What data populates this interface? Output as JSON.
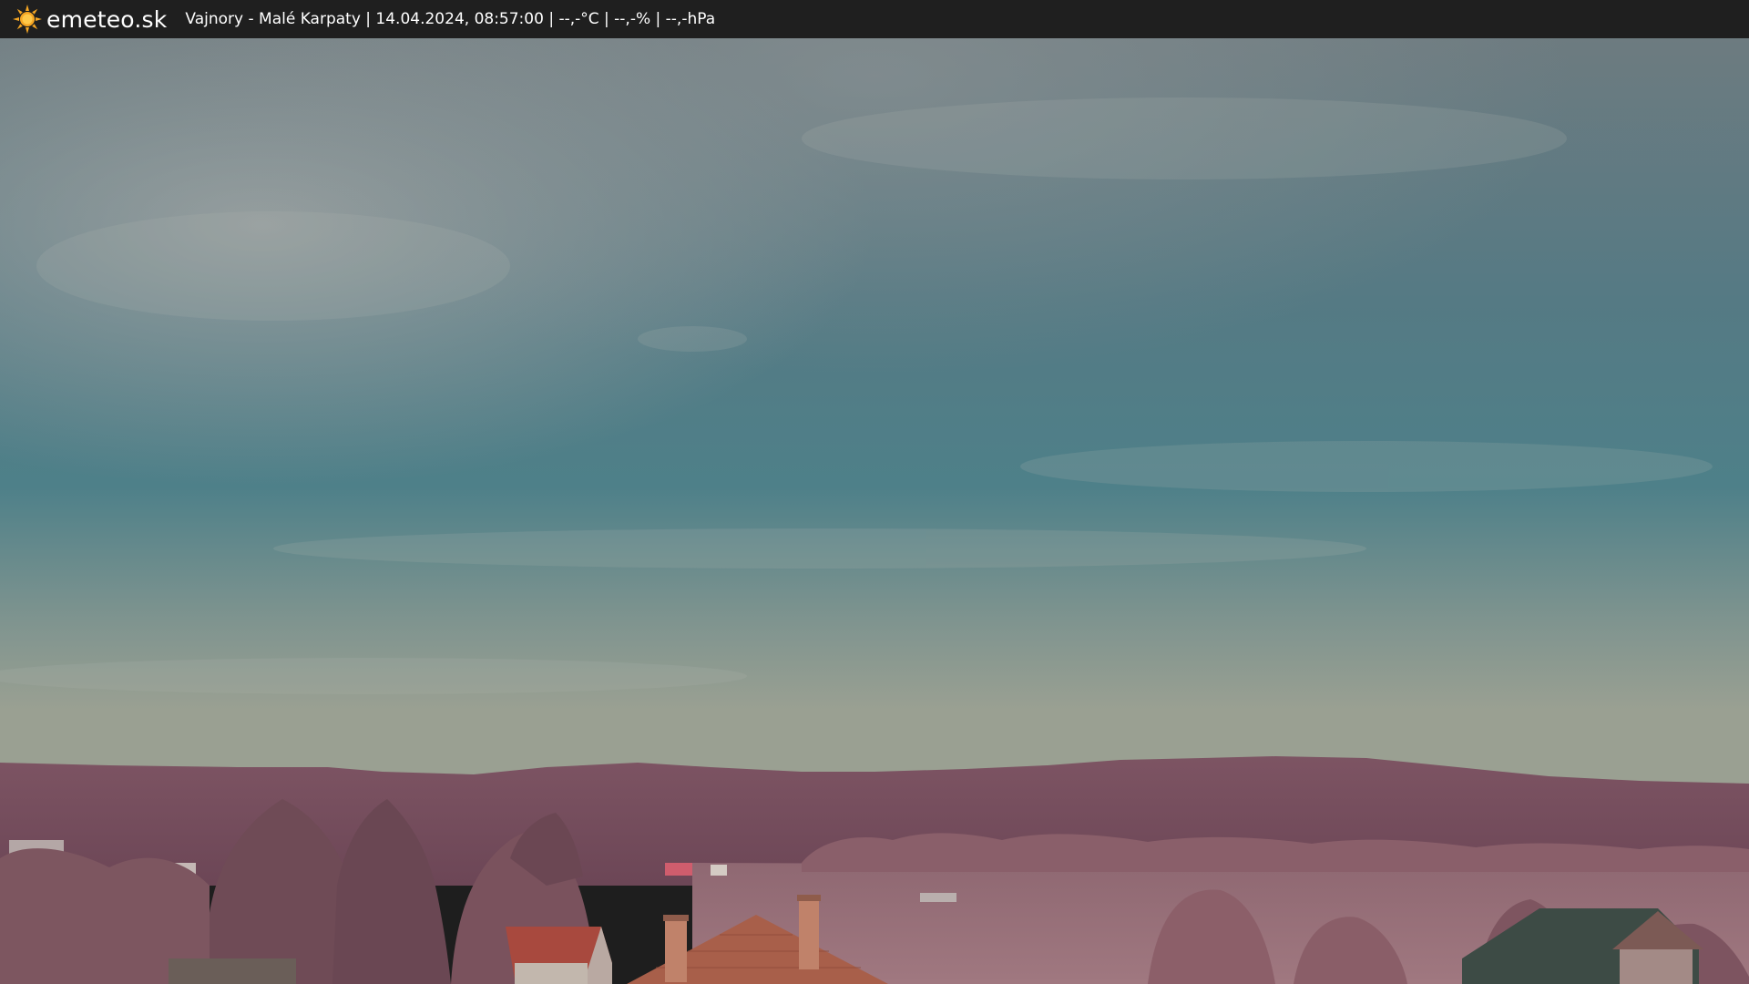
{
  "header": {
    "brand": "emeteo.sk",
    "caption": "Vajnory - Malé Karpaty | 14.04.2024, 08:57:00 | --,-°C | --,-% | --,-hPa",
    "logo_icon": "sun-icon"
  },
  "colors": {
    "bar": "#1f1f1f",
    "sun": "#f5a623",
    "sky_top": "#6e7d82",
    "sky_mid": "#4f7f8a",
    "sky_horizon": "#8f9a92",
    "hills": "#7a4f5e",
    "foliage": "#9a6a72",
    "roof": "#b3513f"
  }
}
